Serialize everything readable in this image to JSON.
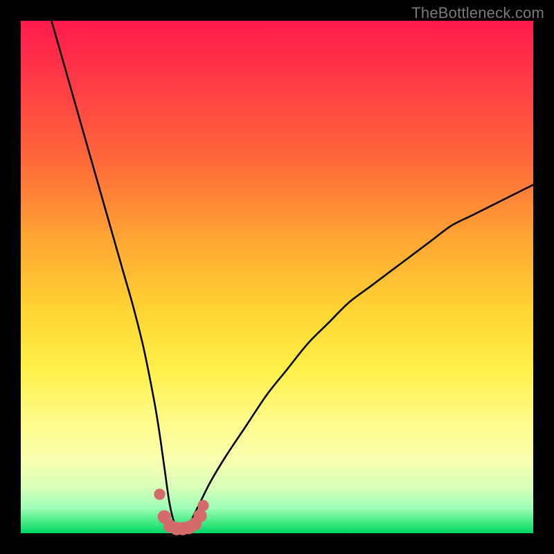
{
  "watermark": "TheBottleneck.com",
  "chart_data": {
    "type": "line",
    "title": "",
    "xlabel": "",
    "ylabel": "",
    "xlim": [
      0,
      100
    ],
    "ylim": [
      0,
      100
    ],
    "grid": false,
    "legend": false,
    "series": [
      {
        "name": "bottleneck-curve",
        "color": "#000000",
        "x": [
          6,
          8,
          10,
          12,
          14,
          16,
          18,
          20,
          22,
          24,
          26,
          27,
          28,
          29,
          30,
          31,
          32,
          33,
          34,
          35,
          37,
          40,
          44,
          48,
          52,
          56,
          60,
          64,
          68,
          72,
          76,
          80,
          84,
          88,
          92,
          96,
          100
        ],
        "values": [
          100,
          93,
          86,
          79,
          72,
          65,
          58,
          51,
          44,
          36,
          26,
          20,
          13,
          6,
          2,
          1,
          1,
          2,
          4,
          6,
          10,
          15,
          21,
          27,
          32,
          37,
          41,
          45,
          48,
          51,
          54,
          57,
          60,
          62,
          64,
          66,
          68
        ]
      }
    ],
    "markers": {
      "name": "min-region-markers",
      "color": "#d46a6a",
      "points": [
        {
          "x": 27.1,
          "y": 7.6,
          "r": 1.1
        },
        {
          "x": 28.0,
          "y": 3.2,
          "r": 1.3
        },
        {
          "x": 29.1,
          "y": 1.4,
          "r": 1.3
        },
        {
          "x": 30.4,
          "y": 0.9,
          "r": 1.3
        },
        {
          "x": 31.6,
          "y": 0.9,
          "r": 1.3
        },
        {
          "x": 32.8,
          "y": 1.1,
          "r": 1.3
        },
        {
          "x": 34.0,
          "y": 1.8,
          "r": 1.3
        },
        {
          "x": 35.0,
          "y": 3.4,
          "r": 1.3
        },
        {
          "x": 35.6,
          "y": 5.4,
          "r": 1.1
        }
      ]
    }
  }
}
